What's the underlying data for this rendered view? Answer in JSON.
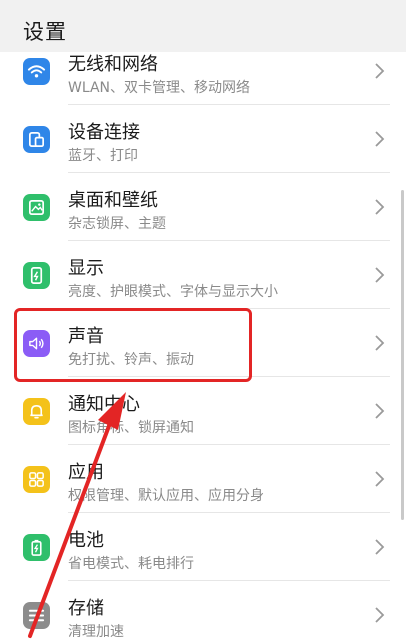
{
  "header": {
    "title": "设置"
  },
  "items": [
    {
      "title": "无线和网络",
      "subtitle": "WLAN、双卡管理、移动网络",
      "icon": "wifi-icon",
      "color": "#2f86e8"
    },
    {
      "title": "设备连接",
      "subtitle": "蓝牙、打印",
      "icon": "device-connect-icon",
      "color": "#2f86e8"
    },
    {
      "title": "桌面和壁纸",
      "subtitle": "杂志锁屏、主题",
      "icon": "wallpaper-icon",
      "color": "#2fbf6b"
    },
    {
      "title": "显示",
      "subtitle": "亮度、护眼模式、字体与显示大小",
      "icon": "display-icon",
      "color": "#2fbf6b"
    },
    {
      "title": "声音",
      "subtitle": "免打扰、铃声、振动",
      "icon": "sound-icon",
      "color": "#8b5cf6"
    },
    {
      "title": "通知中心",
      "subtitle": "图标角标、锁屏通知",
      "icon": "bell-icon",
      "color": "#f4c21a"
    },
    {
      "title": "应用",
      "subtitle": "权限管理、默认应用、应用分身",
      "icon": "apps-icon",
      "color": "#f4c21a"
    },
    {
      "title": "电池",
      "subtitle": "省电模式、耗电排行",
      "icon": "battery-icon",
      "color": "#2fbf6b"
    },
    {
      "title": "存储",
      "subtitle": "清理加速",
      "icon": "storage-icon",
      "color": "#8c8c8c"
    }
  ],
  "annotation": {
    "highlight_color": "#e32525",
    "highlighted_item": "声音"
  }
}
